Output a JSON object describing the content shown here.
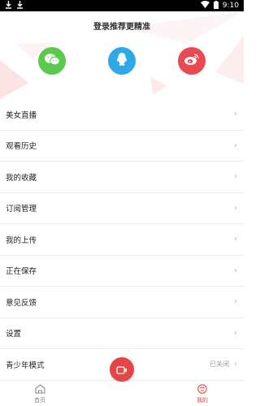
{
  "status_bar": {
    "time": "9:10"
  },
  "header": {
    "login_title": "登录推荐更精准"
  },
  "social_login": [
    {
      "name": "wechat",
      "icon": "wechat-icon",
      "color": "#5bc94e"
    },
    {
      "name": "qq",
      "icon": "qq-icon",
      "color": "#2ea8e6"
    },
    {
      "name": "weibo",
      "icon": "weibo-icon",
      "color": "#ea4a4f"
    }
  ],
  "menu": {
    "items": [
      {
        "label": "美女直播"
      },
      {
        "label": "观看历史"
      },
      {
        "label": "我的收藏"
      },
      {
        "label": "订阅管理"
      },
      {
        "label": "我的上传"
      },
      {
        "label": "正在保存"
      },
      {
        "label": "意见反馈"
      },
      {
        "label": "设置"
      },
      {
        "label": "青少年模式",
        "value": "已关闭"
      }
    ]
  },
  "bottom_nav": {
    "home_label": "首页",
    "mine_label": "我的",
    "accent": "#e64545"
  }
}
